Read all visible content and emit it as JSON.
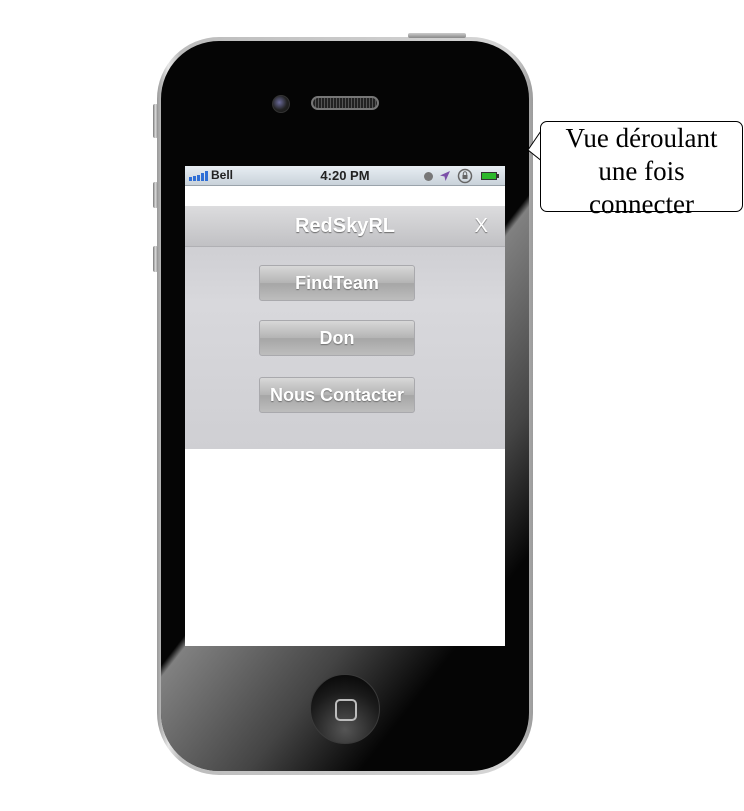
{
  "status_bar": {
    "carrier": "Bell",
    "time": "4:20 PM",
    "signal_color": "#2f6fd6",
    "icons": [
      "clock-icon",
      "location-arrow-icon",
      "rotation-lock-icon",
      "battery-icon"
    ]
  },
  "nav_bar": {
    "title": "RedSkyRL",
    "close_label": "X"
  },
  "menu": {
    "items": [
      {
        "label": "FindTeam"
      },
      {
        "label": "Don"
      },
      {
        "label": "Nous Contacter"
      }
    ]
  },
  "callout": {
    "lines": [
      "Vue déroulant",
      "une fois",
      "connecter"
    ]
  }
}
